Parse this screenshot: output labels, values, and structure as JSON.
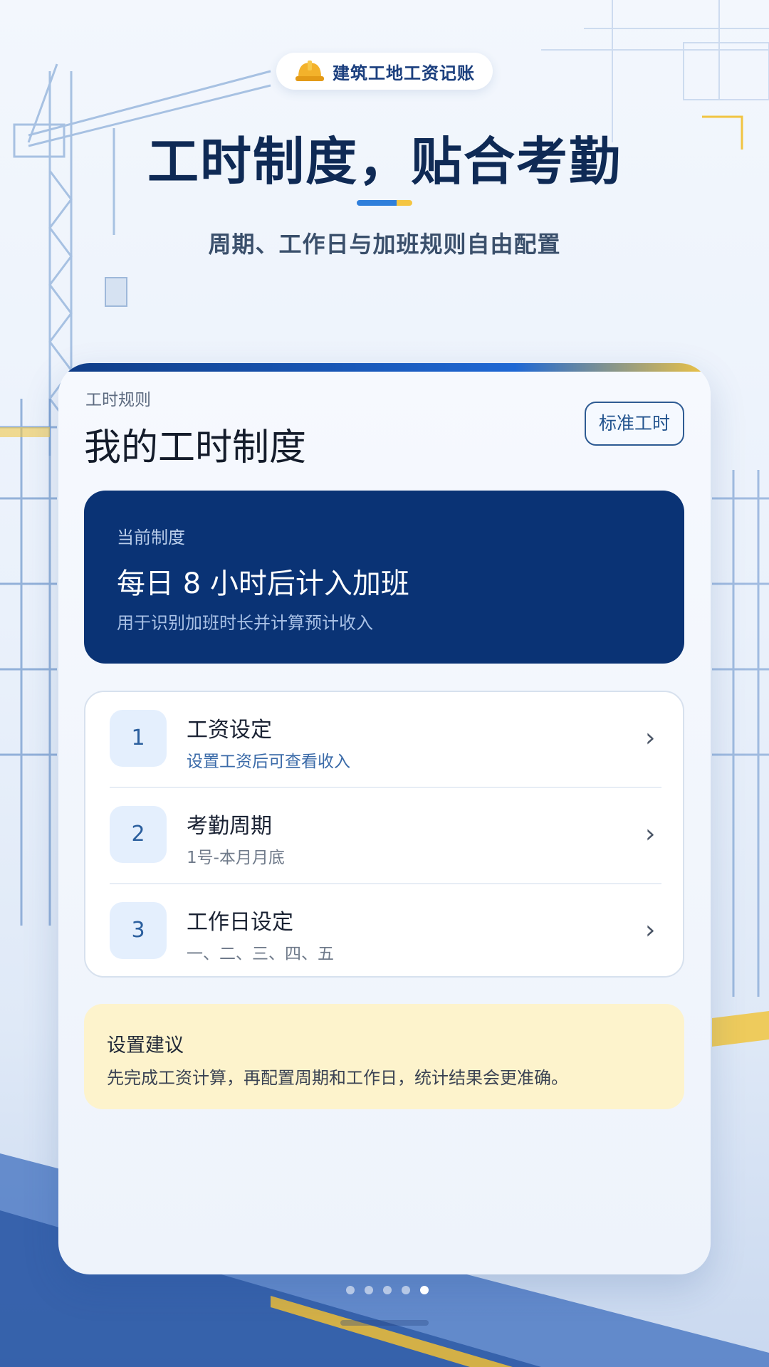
{
  "app": {
    "name": "建筑工地工资记账",
    "icon": "hard-hat-icon"
  },
  "hero": {
    "title": "工时制度，贴合考勤",
    "subtitle": "周期、工作日与加班规则自由配置"
  },
  "card": {
    "eyebrow": "工时规则",
    "title": "我的工时制度",
    "standard_button": "标准工时",
    "current": {
      "label": "当前制度",
      "main": "每日 8 小时后计入加班",
      "desc": "用于识别加班时长并计算预计收入"
    },
    "items": [
      {
        "num": "1",
        "title": "工资设定",
        "subtitle": "设置工资后可查看收入"
      },
      {
        "num": "2",
        "title": "考勤周期",
        "subtitle": "1号-本月月底"
      },
      {
        "num": "3",
        "title": "工作日设定",
        "subtitle": "一、二、三、四、五"
      }
    ],
    "advice": {
      "title": "设置建议",
      "text": "先完成工资计算，再配置周期和工作日，统计结果会更准确。"
    }
  },
  "pager": {
    "count": 5,
    "active": 5
  },
  "colors": {
    "primary_dark": "#0a3375",
    "accent_blue": "#2f7fdb",
    "accent_yellow": "#f4c542",
    "advice_bg": "#fdf3cc"
  }
}
